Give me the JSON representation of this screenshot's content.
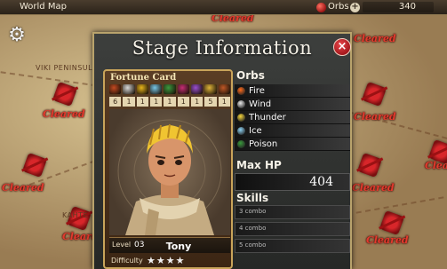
{
  "topbar": {
    "title": "World Map",
    "orbs_label": "Orbs",
    "orbs_count": "340",
    "plus": "+"
  },
  "map": {
    "cleared_labels": [
      "Cleared",
      "Cleared",
      "Cleared",
      "Cleared",
      "Cleared",
      "Cleared",
      "Cleared",
      "Cleared",
      "Cleared"
    ],
    "places": [
      "VIKI PENINSULA",
      "KAHTE"
    ]
  },
  "dialog": {
    "title": "Stage Information",
    "close": "×"
  },
  "card": {
    "title": "Fortune Card",
    "counts": [
      "6",
      "1",
      "1",
      "1",
      "1",
      "1",
      "1",
      "5",
      "1"
    ],
    "icon_colors": [
      "#c44a21",
      "#d9d9d9",
      "#e8b41b",
      "#78c7e8",
      "#3c9a3f",
      "#c62d74",
      "#9a4fd0",
      "#e0b43a",
      "#bf5826"
    ],
    "level_label": "Level",
    "level": "03",
    "name": "Tony",
    "difficulty_label": "Difficulty",
    "difficulty_stars": "★★★★",
    "difficulty_level": 4
  },
  "orbs": {
    "header": "Orbs",
    "items": [
      {
        "name": "Fire",
        "color": "#ff6a1a",
        "icon": "fire-icon"
      },
      {
        "name": "Wind",
        "color": "#e8e8e8",
        "icon": "wind-icon"
      },
      {
        "name": "Thunder",
        "color": "#f4d43a",
        "icon": "thunder-icon"
      },
      {
        "name": "Ice",
        "color": "#8ed3f4",
        "icon": "ice-icon"
      },
      {
        "name": "Poison",
        "color": "#3a9a3c",
        "icon": "poison-icon"
      }
    ]
  },
  "max_hp": {
    "header": "Max HP",
    "value": "404"
  },
  "skills": {
    "header": "Skills",
    "items": [
      "3 combo",
      "4 combo",
      "5 combo"
    ]
  }
}
